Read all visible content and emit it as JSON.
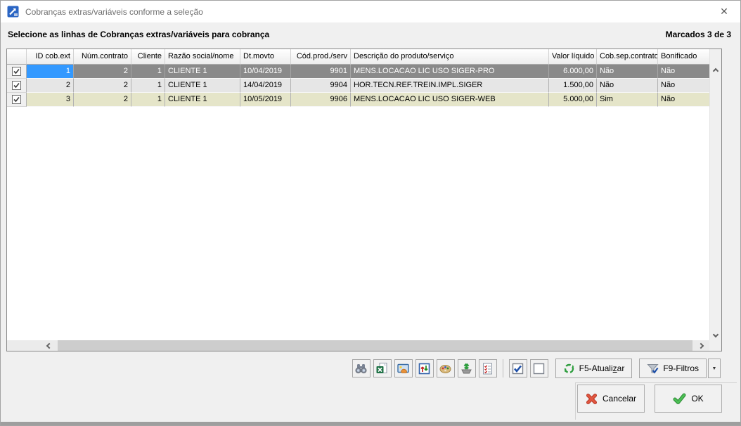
{
  "window": {
    "title": "Cobranças extras/variáveis conforme a seleção",
    "close_icon": "✕"
  },
  "header": {
    "instruction": "Selecione as linhas de Cobranças extras/variáveis para cobrança",
    "marked": "Marcados 3 de 3"
  },
  "table": {
    "columns": {
      "check": "",
      "id": "ID cob.ext",
      "contrato": "Núm.contrato",
      "cliente": "Cliente",
      "razao": "Razão social/nome",
      "dt": "Dt.movto",
      "cod": "Cód.prod./serv",
      "desc": "Descrição do produto/serviço",
      "valor": "Valor líquido",
      "cobsep": "Cob.sep.contrato",
      "bonificado": "Bonificado"
    },
    "rows": [
      {
        "checked": true,
        "id": "1",
        "contrato": "2",
        "cliente": "1",
        "razao": "CLIENTE 1",
        "dt": "10/04/2019",
        "cod": "9901",
        "desc": "MENS.LOCACAO LIC USO SIGER-PRO",
        "valor": "6.000,00",
        "cobsep": "Não",
        "bonificado": "Não"
      },
      {
        "checked": true,
        "id": "2",
        "contrato": "2",
        "cliente": "1",
        "razao": "CLIENTE 1",
        "dt": "14/04/2019",
        "cod": "9904",
        "desc": "HOR.TECN.REF.TREIN.IMPL.SIGER",
        "valor": "1.500,00",
        "cobsep": "Não",
        "bonificado": "Não"
      },
      {
        "checked": true,
        "id": "3",
        "contrato": "2",
        "cliente": "1",
        "razao": "CLIENTE 1",
        "dt": "10/05/2019",
        "cod": "9906",
        "desc": "MENS.LOCACAO LIC USO SIGER-WEB",
        "valor": "5.000,00",
        "cobsep": "Sim",
        "bonificado": "Não"
      }
    ]
  },
  "toolbar": {
    "icons": [
      "binoculars-icon",
      "excel-export-icon",
      "image-export-icon",
      "sort-values-icon",
      "palette-icon",
      "export-download-icon",
      "checklist-icon",
      "check-all-icon",
      "uncheck-all-icon"
    ],
    "check_all_checked": true,
    "uncheck_all_checked": false,
    "refresh": {
      "pre": "F5-Atuali",
      "accel": "z",
      "post": "ar"
    },
    "filters_label": "F9-Filtros",
    "dropdown_icon": "▼"
  },
  "footer": {
    "cancel_label": "Cancelar",
    "ok_label": "OK"
  },
  "colors": {
    "accent_blue": "#3399ff",
    "selected_row_gray": "#8a8a8a",
    "row_gray": "#e6e6e6",
    "row_beige": "#e5e5c9",
    "cancel_red": "#d9442c",
    "ok_green": "#3fae49"
  }
}
